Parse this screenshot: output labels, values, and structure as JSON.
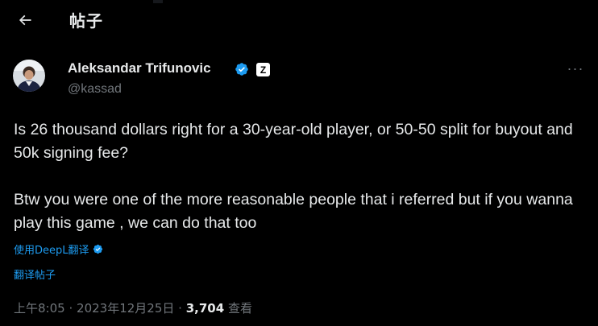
{
  "header": {
    "title": "帖子",
    "back_icon": "arrow-left-icon"
  },
  "author": {
    "name": "Aleksandar Trifunovic",
    "handle": "@kassad",
    "verified": true,
    "affiliate_badge": "Z"
  },
  "post": {
    "paragraphs": [
      "Is 26 thousand dollars right for a 30-year-old player, or 50-50 split for buyout and 50k signing fee?",
      "Btw you were one of the more reasonable people that i referred but if you wanna play this game , we can do that too"
    ],
    "deepl_label": "使用DeepL翻译",
    "translate_label": "翻译帖子"
  },
  "meta": {
    "time": "上午8:05",
    "separator": "·",
    "date": "2023年12月25日",
    "views_count": "3,704",
    "views_label": "查看"
  },
  "colors": {
    "background": "#000000",
    "text": "#e7e9ea",
    "secondary": "#71767b",
    "accent": "#1d9bf0"
  }
}
